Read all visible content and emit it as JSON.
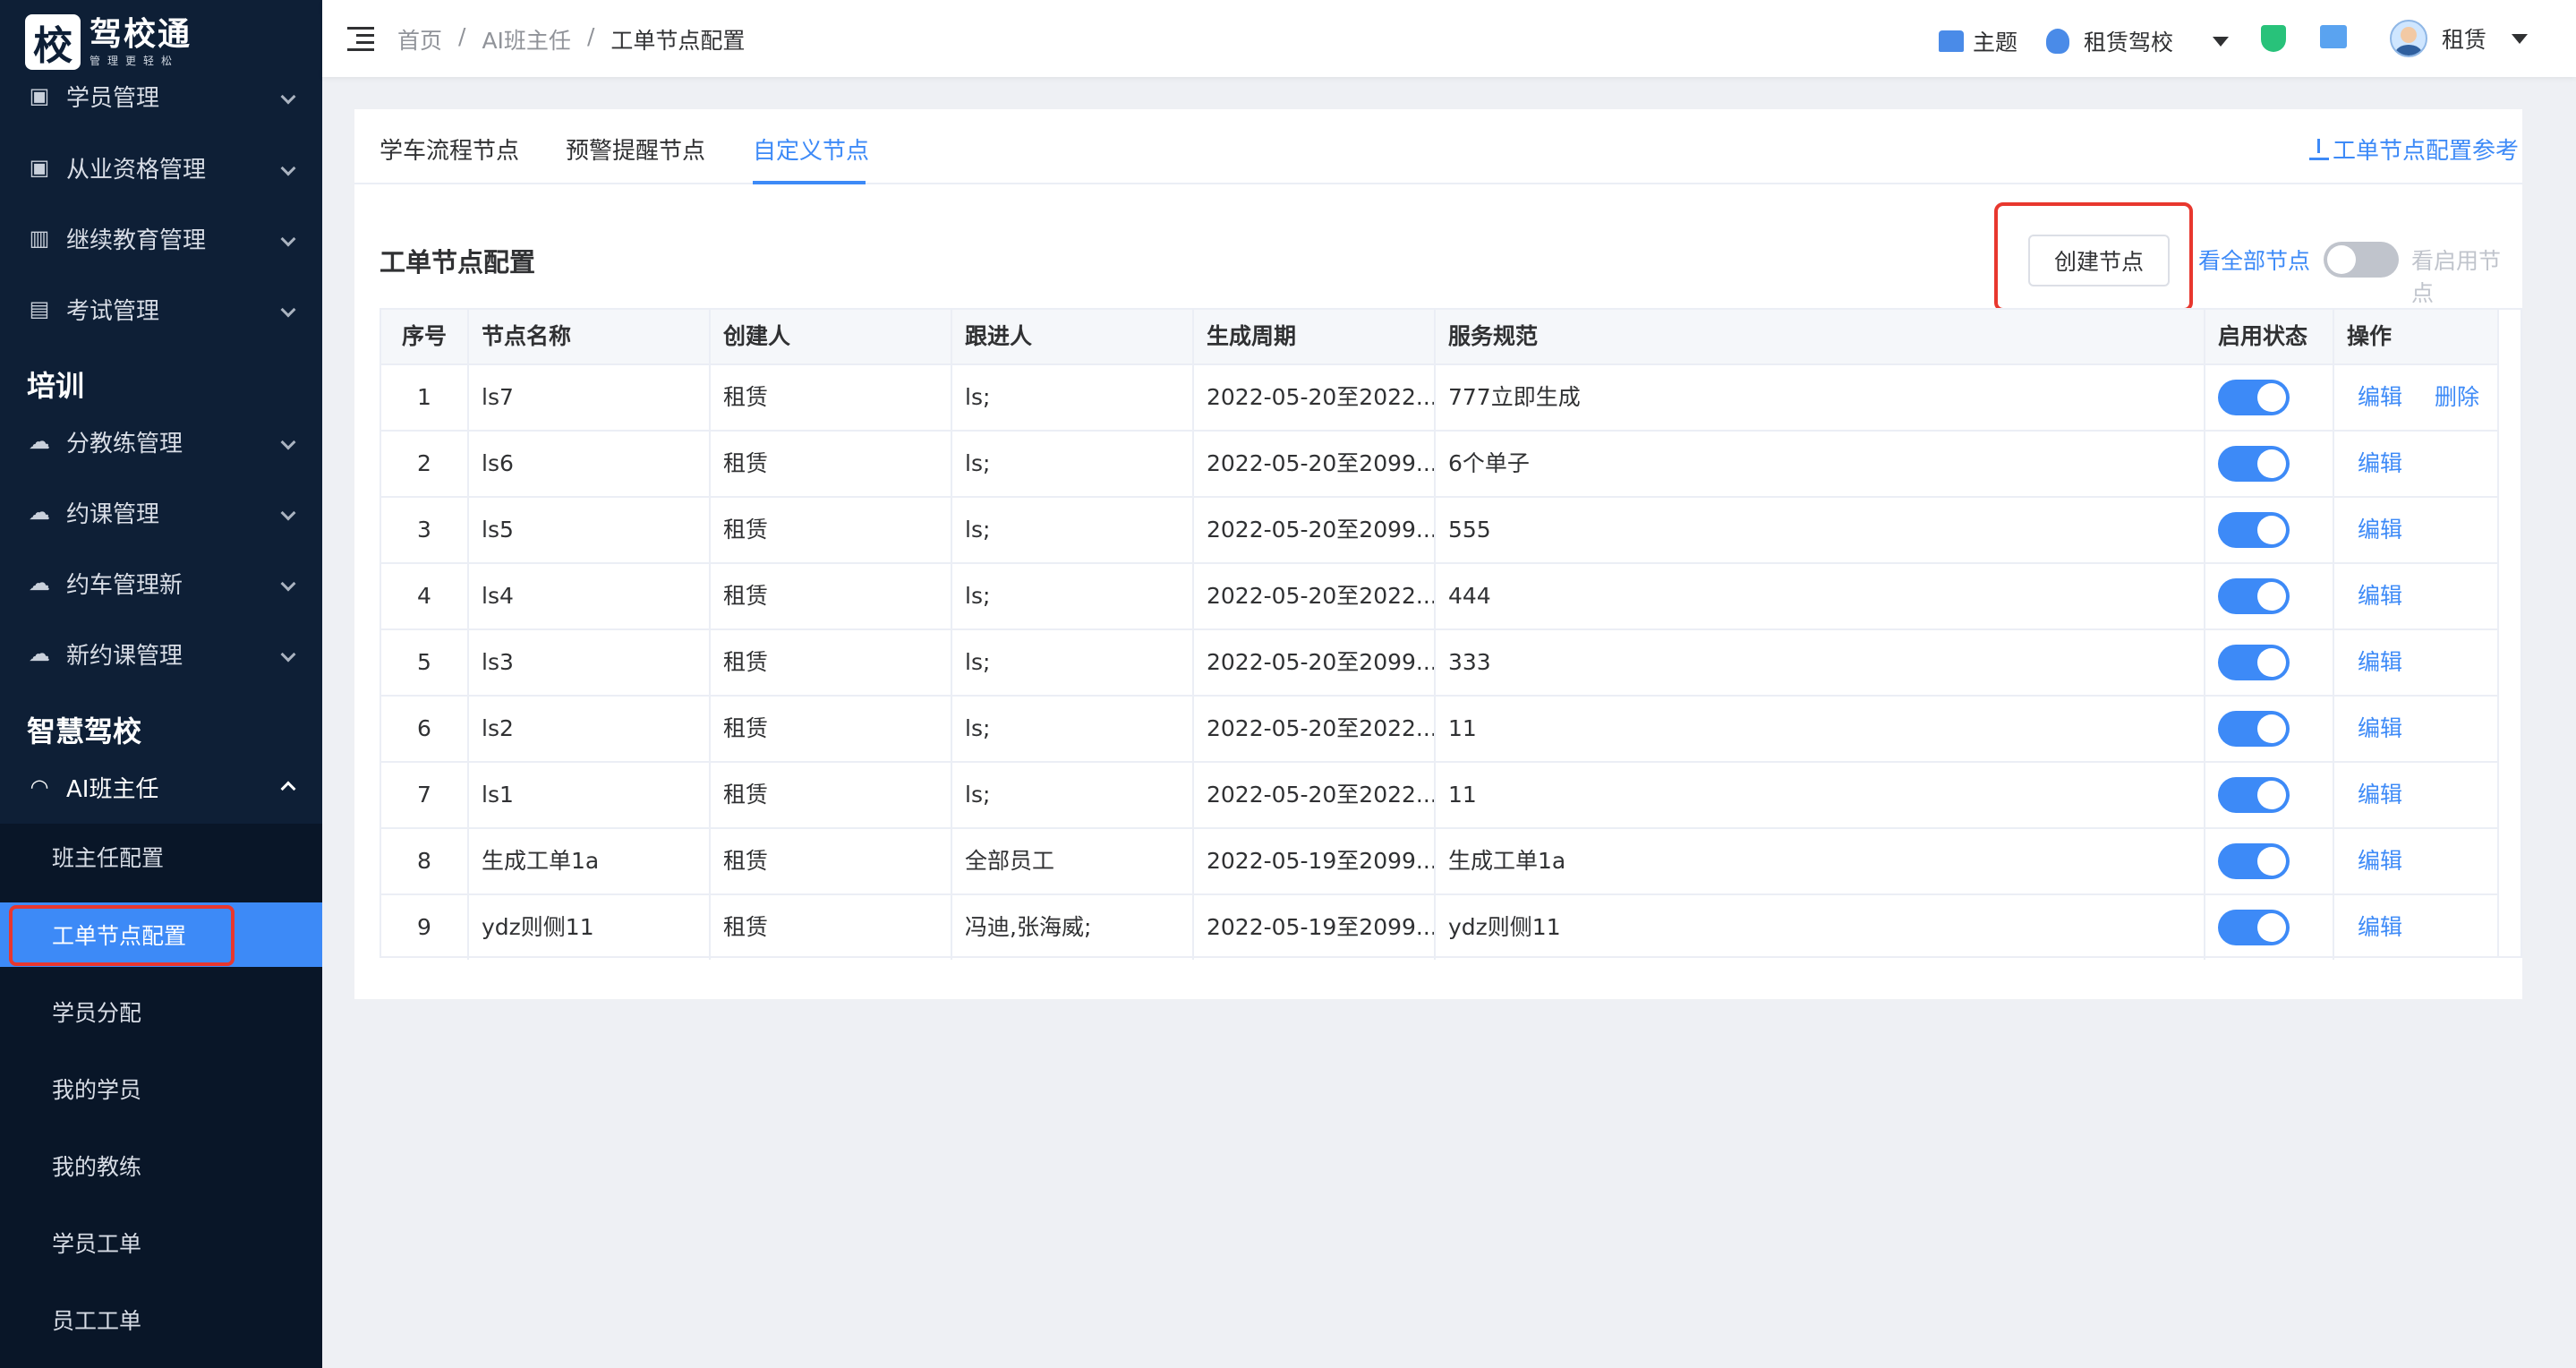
{
  "logo": {
    "glyph": "校",
    "name": "驾校通",
    "tagline": "管理更轻松"
  },
  "sidebar": {
    "items": [
      {
        "label": "学员管理",
        "icon": "id-card-icon"
      },
      {
        "label": "从业资格管理",
        "icon": "certificate-icon"
      },
      {
        "label": "继续教育管理",
        "icon": "book-icon"
      },
      {
        "label": "考试管理",
        "icon": "exam-icon"
      }
    ],
    "section_training": "培训",
    "training_items": [
      {
        "label": "分教练管理",
        "icon": "cloud-icon"
      },
      {
        "label": "约课管理",
        "icon": "cloud-icon"
      },
      {
        "label": "约车管理新",
        "icon": "cloud-icon"
      },
      {
        "label": "新约课管理",
        "icon": "cloud-icon"
      }
    ],
    "section_smart": "智慧驾校",
    "ai_item": {
      "label": "AI班主任",
      "icon": "headset-icon"
    },
    "sub_items": [
      "班主任配置",
      "工单节点配置",
      "学员分配",
      "我的学员",
      "我的教练",
      "学员工单",
      "员工工单"
    ]
  },
  "header": {
    "breadcrumb": [
      "首页",
      "AI班主任",
      "工单节点配置"
    ],
    "separator": "/",
    "theme_label": "主题",
    "school_label": "租赁驾校",
    "user_label": "租赁"
  },
  "tabs": [
    "学车流程节点",
    "预警提醒节点",
    "自定义节点"
  ],
  "ref_link": "工单节点配置参考",
  "card_title": "工单节点配置",
  "create_button": "创建节点",
  "view_all": "看全部节点",
  "view_enabled": "看启用节点",
  "table": {
    "headers": [
      "序号",
      "节点名称",
      "创建人",
      "跟进人",
      "生成周期",
      "服务规范",
      "启用状态",
      "操作"
    ],
    "rows": [
      {
        "no": "1",
        "name": "ls7",
        "creator": "租赁",
        "follower": "ls;",
        "period": "2022-05-20至2022...",
        "spec": "777立即生成",
        "edit": "编辑",
        "delete": "删除"
      },
      {
        "no": "2",
        "name": "ls6",
        "creator": "租赁",
        "follower": "ls;",
        "period": "2022-05-20至2099...",
        "spec": "6个单子",
        "edit": "编辑"
      },
      {
        "no": "3",
        "name": "ls5",
        "creator": "租赁",
        "follower": "ls;",
        "period": "2022-05-20至2099...",
        "spec": "555",
        "edit": "编辑"
      },
      {
        "no": "4",
        "name": "ls4",
        "creator": "租赁",
        "follower": "ls;",
        "period": "2022-05-20至2022...",
        "spec": "444",
        "edit": "编辑"
      },
      {
        "no": "5",
        "name": "ls3",
        "creator": "租赁",
        "follower": "ls;",
        "period": "2022-05-20至2099...",
        "spec": "333",
        "edit": "编辑"
      },
      {
        "no": "6",
        "name": "ls2",
        "creator": "租赁",
        "follower": "ls;",
        "period": "2022-05-20至2022...",
        "spec": "11",
        "edit": "编辑"
      },
      {
        "no": "7",
        "name": "ls1",
        "creator": "租赁",
        "follower": "ls;",
        "period": "2022-05-20至2022...",
        "spec": "11",
        "edit": "编辑"
      },
      {
        "no": "8",
        "name": "生成工单1a",
        "creator": "租赁",
        "follower": "全部员工",
        "period": "2022-05-19至2099...",
        "spec": "生成工单1a",
        "edit": "编辑"
      },
      {
        "no": "9",
        "name": "ydz则侧11",
        "creator": "租赁",
        "follower": "冯迪,张海威;",
        "period": "2022-05-19至2099...",
        "spec": "ydz则侧11",
        "edit": "编辑"
      }
    ]
  },
  "colors": {
    "accent": "#3d8af7",
    "sidebar": "#0e1f36",
    "highlight": "#e8372e"
  }
}
